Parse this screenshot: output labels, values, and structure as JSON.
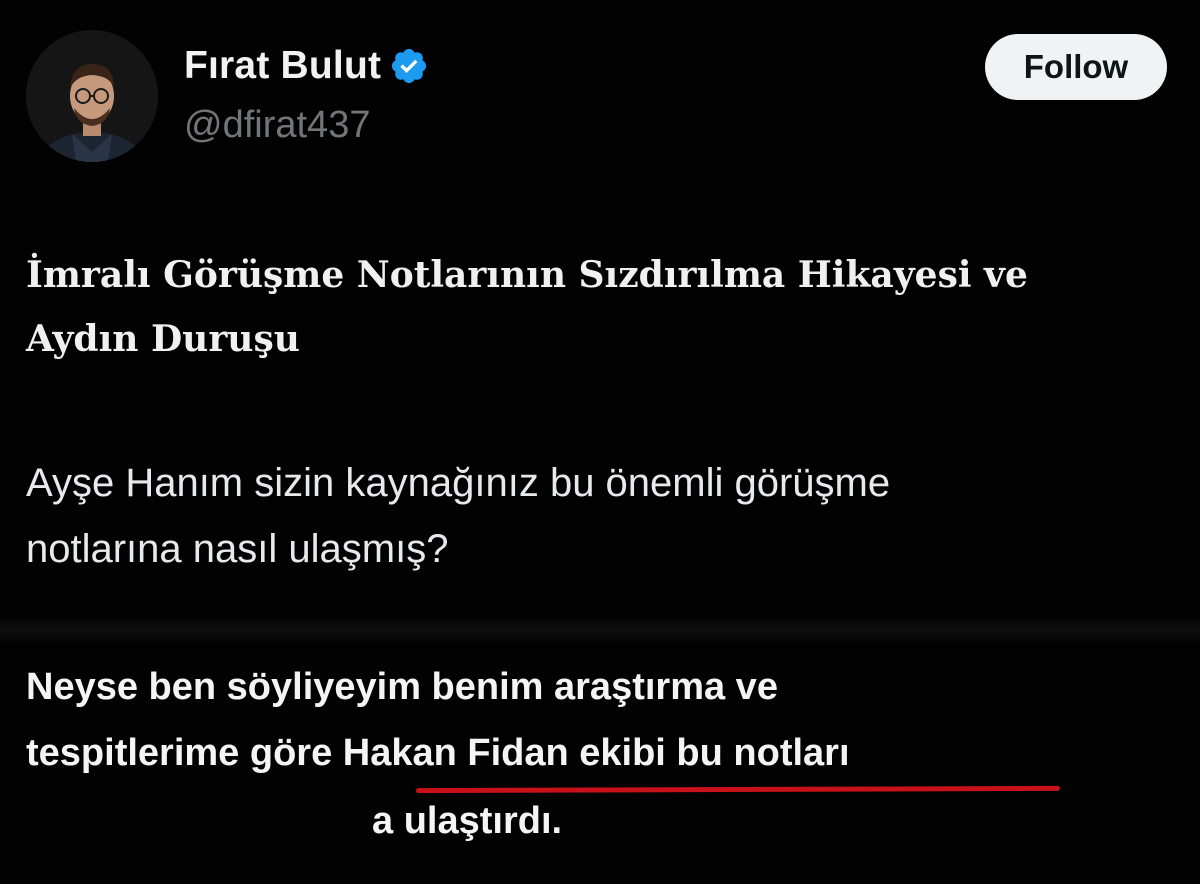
{
  "profile": {
    "display_name": "Fırat Bulut",
    "handle": "@dfirat437",
    "verified_icon": "verified-badge-icon",
    "verified_color": "#1d9bf0"
  },
  "follow_button": {
    "label": "Follow"
  },
  "post": {
    "headline_lines": [
      "İmralı Görüşme Notlarının Sızdırılma Hikayesi ve",
      "Aydın Duruşu"
    ],
    "question_lines": [
      "Ayşe Hanım sizin kaynağınız bu önemli görüşme",
      "notlarına nasıl ulaşmış?"
    ],
    "answer_lines": [
      "Neyse ben söyliyeyim benim araştırma ve",
      "tespitlerime göre Hakan Fidan ekibi bu notları",
      "a ulaştırdı."
    ]
  },
  "colors": {
    "background": "#020202",
    "follow_bg": "#eff3f4",
    "handle": "#71767b",
    "underline": "#c8111a"
  }
}
